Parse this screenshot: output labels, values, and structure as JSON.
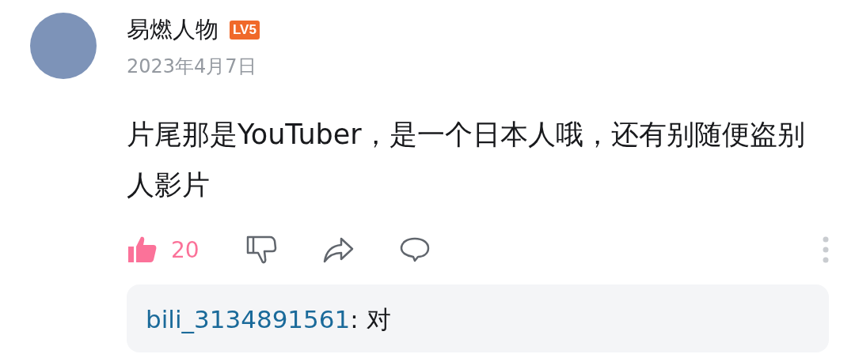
{
  "comment": {
    "username": "易燃人物",
    "level_badge": "LV5",
    "date": "2023年4月7日",
    "text": "片尾那是YouTuber，是一个日本人哦，还有别随便盗别人影片",
    "liked": true,
    "like_count": "20"
  },
  "replies": [
    {
      "user": "bili_3134891561",
      "text": ": 对"
    }
  ]
}
